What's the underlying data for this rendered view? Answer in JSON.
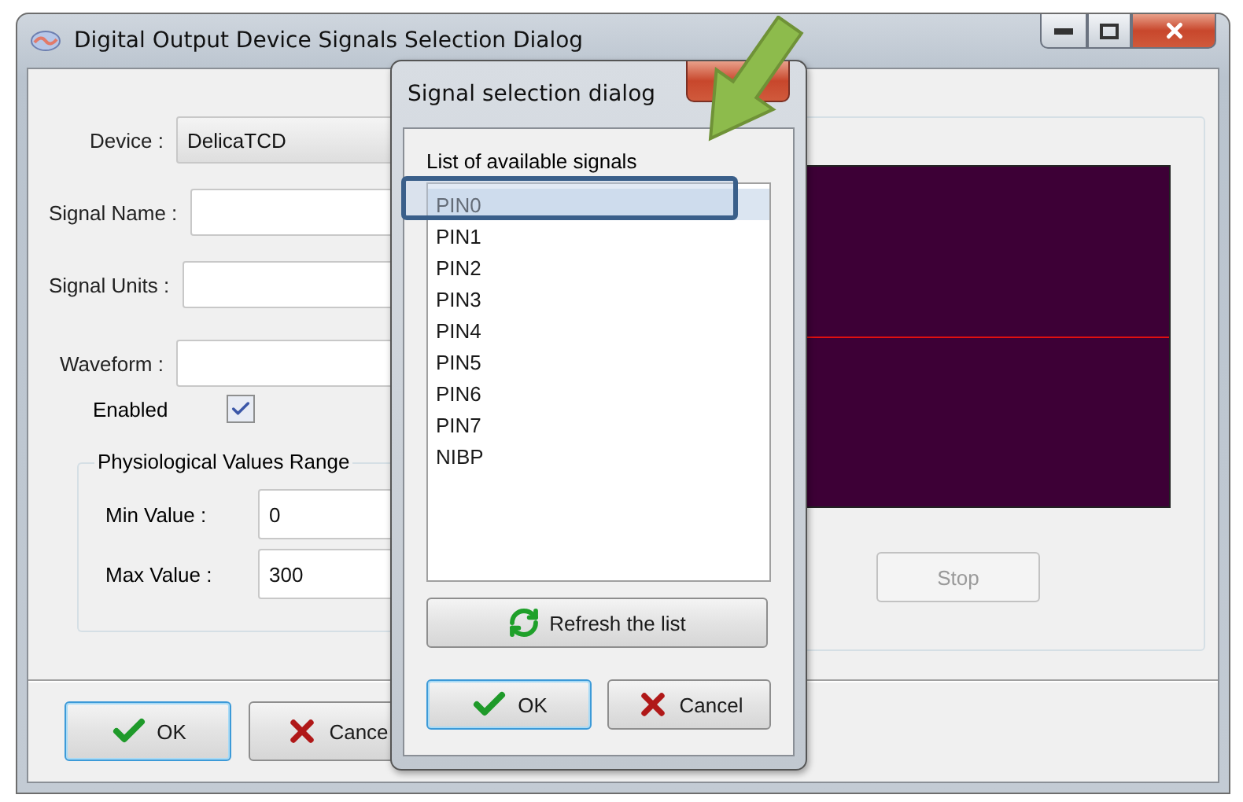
{
  "window": {
    "title": "Digital Output Device Signals Selection Dialog"
  },
  "form": {
    "fields": [
      {
        "label": "Device :",
        "value": "DelicaTCD",
        "kind": "dropdown"
      },
      {
        "label": "Signal Name :",
        "kind": "text"
      },
      {
        "label": "Signal Units :",
        "kind": "text"
      },
      {
        "label": "Waveform :",
        "kind": "text"
      }
    ],
    "enabled": {
      "label": "Enabled",
      "checked": true
    },
    "range_group": {
      "title": "Physiological Values Range",
      "fields": [
        {
          "label": "Min Value :",
          "value": "0"
        },
        {
          "label": "Max Value :",
          "value": "300"
        }
      ]
    }
  },
  "preview": {
    "stop_button": {
      "label": "Stop",
      "disabled": true
    }
  },
  "buttons": [
    {
      "label": "OK",
      "kind": "ok",
      "default": true
    },
    {
      "label": "Cance",
      "kind": "cancel",
      "default": false
    }
  ],
  "signal_dialog": {
    "title": "Signal selection dialog",
    "list_label": "List of available signals",
    "signals": [
      {
        "label": "PIN0",
        "selected": true
      },
      {
        "label": "PIN1",
        "selected": false
      },
      {
        "label": "PIN2",
        "selected": false
      },
      {
        "label": "PIN3",
        "selected": false
      },
      {
        "label": "PIN4",
        "selected": false
      },
      {
        "label": "PIN5",
        "selected": false
      },
      {
        "label": "PIN6",
        "selected": false
      },
      {
        "label": "PIN7",
        "selected": false
      },
      {
        "label": "NIBP",
        "selected": false
      }
    ],
    "refresh_button": "Refresh the list",
    "buttons": [
      {
        "label": "OK",
        "kind": "ok",
        "default": true
      },
      {
        "label": "Cancel",
        "kind": "cancel",
        "default": false
      }
    ]
  }
}
